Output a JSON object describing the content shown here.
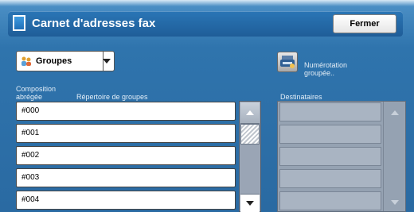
{
  "header": {
    "title": "Carnet d'adresses fax",
    "close_label": "Fermer"
  },
  "dropdown": {
    "selected": "Groupes",
    "icon": "group-people-icon"
  },
  "group_dial": {
    "label": "Numérotation groupée..",
    "icon": "fax-group-icon"
  },
  "columns": {
    "speed_dial": "Composition abrégée",
    "group_directory": "Répertoire de groupes",
    "recipients": "Destinataires"
  },
  "groups": [
    "#000",
    "#001",
    "#002",
    "#003",
    "#004"
  ],
  "recipients": [
    "",
    "",
    "",
    "",
    ""
  ]
}
